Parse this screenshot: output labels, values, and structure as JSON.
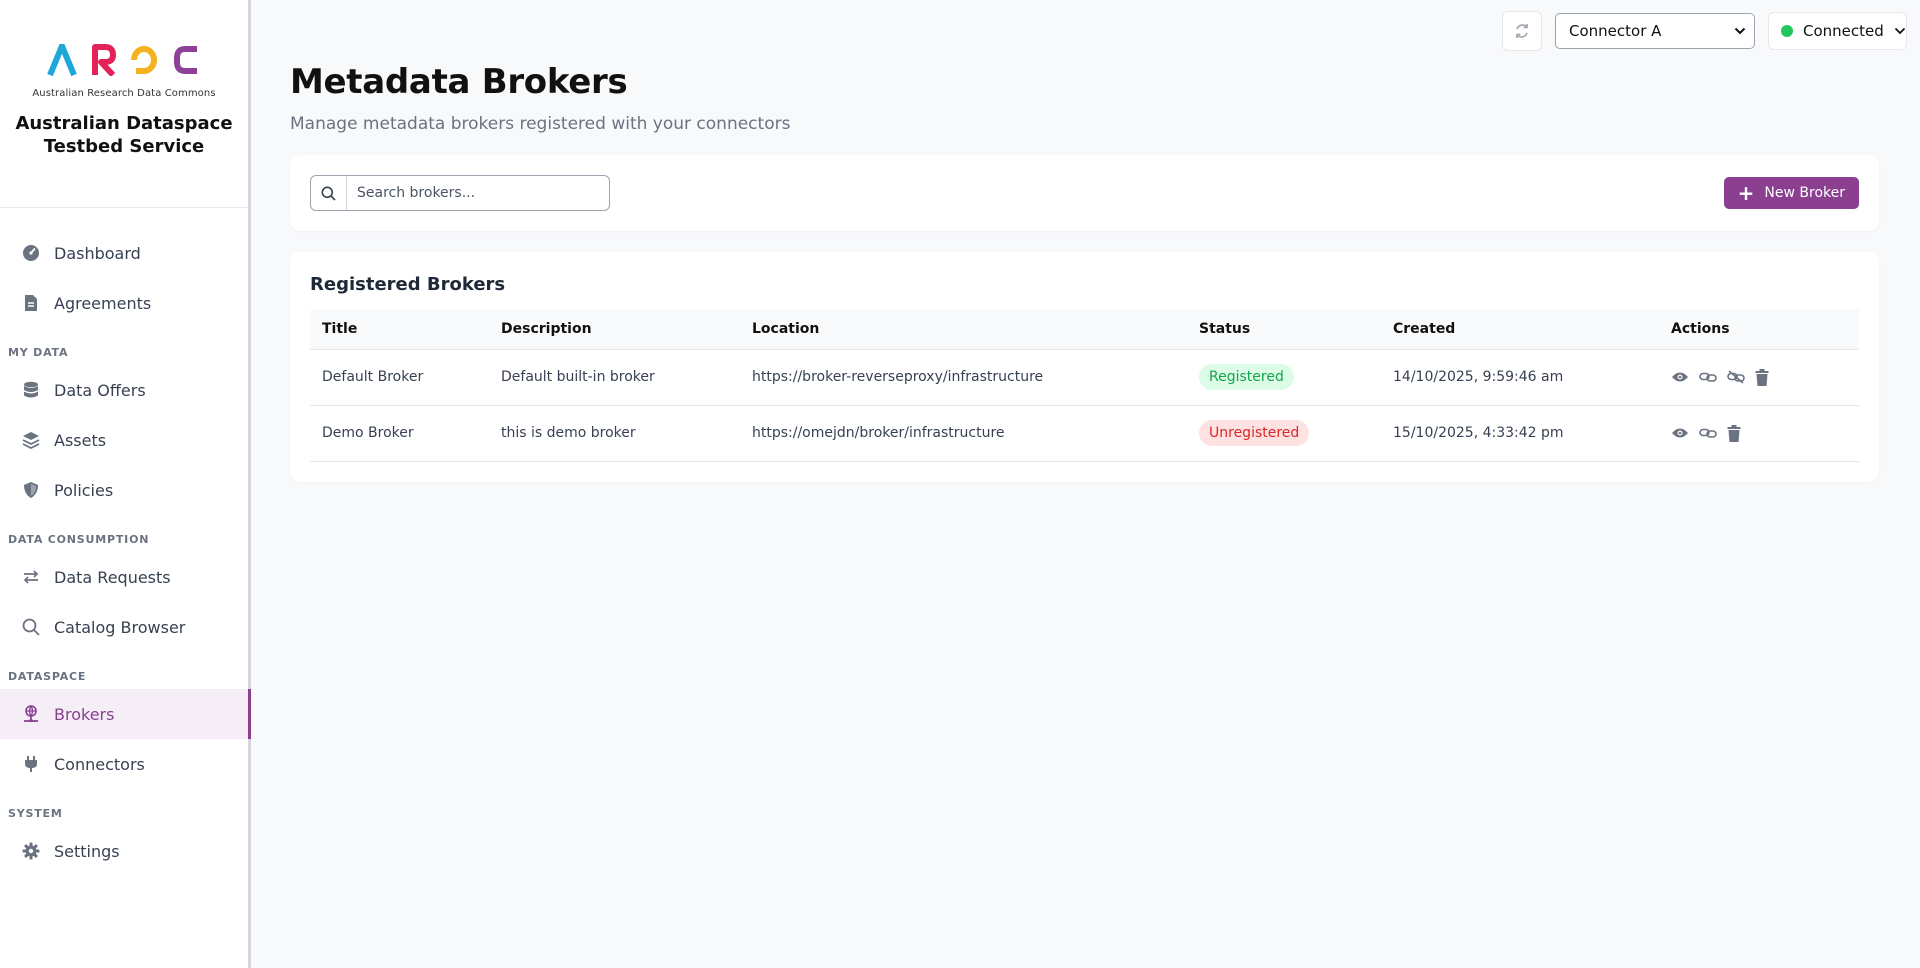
{
  "brand": {
    "logo_letters": [
      {
        "char": "A",
        "color": "#1fa7d8"
      },
      {
        "char": "R",
        "color": "#e5215a"
      },
      {
        "char": "D",
        "color": "#f5b21c"
      },
      {
        "char": "C",
        "color": "#8e4096"
      }
    ],
    "logo_subtitle": "Australian Research Data Commons",
    "title": "Australian Dataspace Testbed Service"
  },
  "sidebar": {
    "items": [
      {
        "label": "Dashboard",
        "icon": "dashboard-gauge-icon"
      },
      {
        "label": "Agreements",
        "icon": "document-icon"
      }
    ],
    "sections": [
      {
        "title": "MY DATA",
        "items": [
          {
            "label": "Data Offers",
            "icon": "database-icon"
          },
          {
            "label": "Assets",
            "icon": "layers-icon"
          },
          {
            "label": "Policies",
            "icon": "shield-icon"
          }
        ]
      },
      {
        "title": "DATA CONSUMPTION",
        "items": [
          {
            "label": "Data Requests",
            "icon": "arrows-exchange-icon"
          },
          {
            "label": "Catalog Browser",
            "icon": "search-icon"
          }
        ]
      },
      {
        "title": "DATASPACE",
        "items": [
          {
            "label": "Brokers",
            "icon": "broker-network-icon",
            "active": true
          },
          {
            "label": "Connectors",
            "icon": "plug-icon"
          }
        ]
      },
      {
        "title": "SYSTEM",
        "items": [
          {
            "label": "Settings",
            "icon": "gear-icon"
          }
        ]
      }
    ]
  },
  "topbar": {
    "connector_selected": "Connector A",
    "status_label": "Connected",
    "status_color": "#22c55e"
  },
  "page": {
    "title": "Metadata Brokers",
    "subtitle": "Manage metadata brokers registered with your connectors"
  },
  "search": {
    "placeholder": "Search brokers...",
    "value": ""
  },
  "new_button_label": "New Broker",
  "table": {
    "title": "Registered Brokers",
    "columns": [
      "Title",
      "Description",
      "Location",
      "Status",
      "Created",
      "Actions"
    ],
    "rows": [
      {
        "title": "Default Broker",
        "description": "Default built-in broker",
        "location": "https://broker-reverseproxy/infrastructure",
        "status": "Registered",
        "created": "14/10/2025, 9:59:46 am"
      },
      {
        "title": "Demo Broker",
        "description": "this is demo broker",
        "location": "https://omejdn/broker/infrastructure",
        "status": "Unregistered",
        "created": "15/10/2025, 4:33:42 pm"
      }
    ]
  },
  "colors": {
    "accent": "#8a3f91",
    "registered": "#16a34a",
    "unregistered": "#dc2626"
  }
}
